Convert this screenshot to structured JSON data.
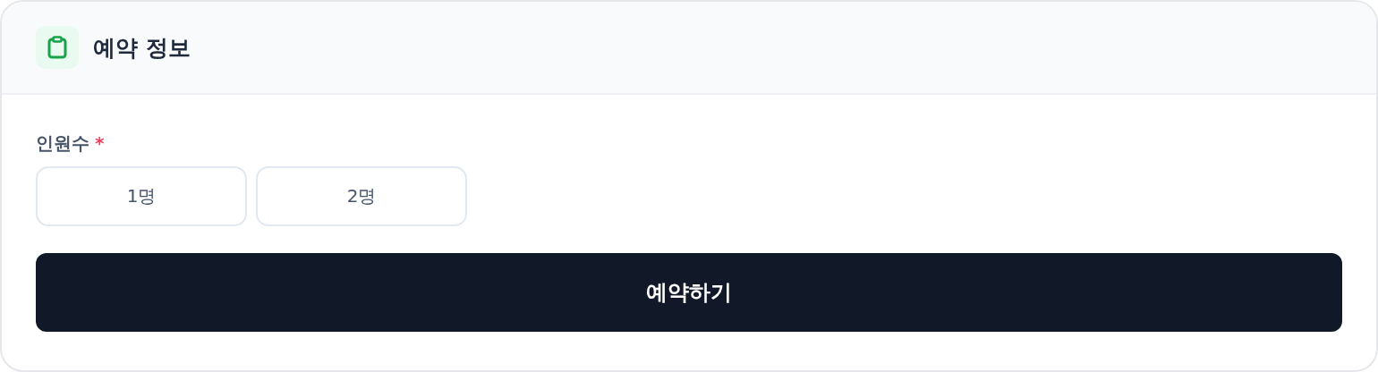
{
  "header": {
    "title": "예약 정보"
  },
  "field": {
    "label": "인원수",
    "required_mark": "*"
  },
  "options": [
    {
      "label": "1명",
      "selected": false
    },
    {
      "label": "2명",
      "selected": false
    }
  ],
  "submit": {
    "label": "예약하기"
  }
}
